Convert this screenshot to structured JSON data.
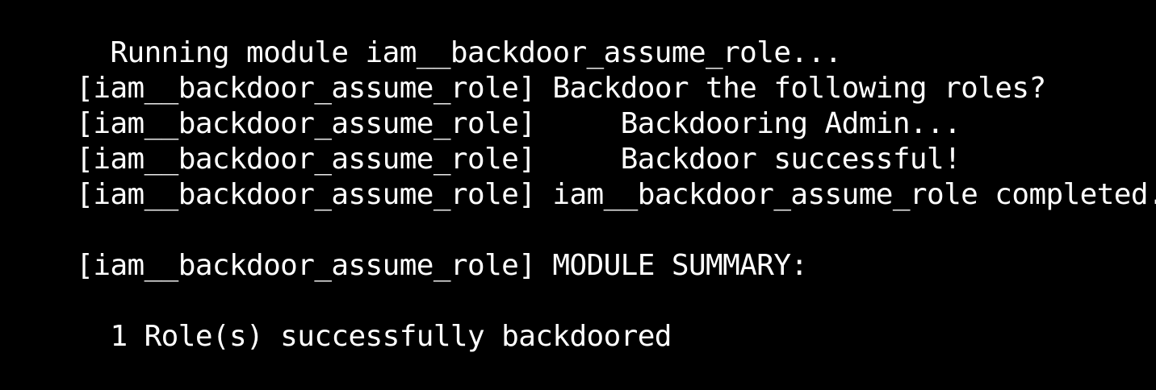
{
  "terminal": {
    "colors": {
      "background": "#000000",
      "foreground": "#ffffff"
    },
    "lines": [
      {
        "prefix": "",
        "text": "  Running module iam__backdoor_assume_role..."
      },
      {
        "prefix": "[iam__backdoor_assume_role]",
        "text": " Backdoor the following roles?"
      },
      {
        "prefix": "[iam__backdoor_assume_role]",
        "text": "     Backdooring Admin..."
      },
      {
        "prefix": "[iam__backdoor_assume_role]",
        "text": "     Backdoor successful!"
      },
      {
        "prefix": "[iam__backdoor_assume_role]",
        "text": " iam__backdoor_assume_role completed."
      },
      {
        "prefix": "",
        "text": ""
      },
      {
        "prefix": "[iam__backdoor_assume_role]",
        "text": " MODULE SUMMARY:"
      },
      {
        "prefix": "",
        "text": ""
      },
      {
        "prefix": "",
        "text": "  1 Role(s) successfully backdoored"
      }
    ]
  }
}
